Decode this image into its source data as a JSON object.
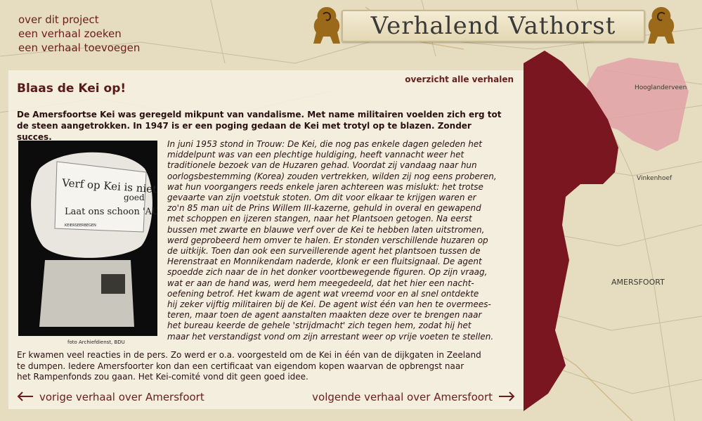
{
  "site": {
    "banner_title": "Verhalend Vathorst"
  },
  "nav": {
    "items": [
      "over dit project",
      "een verhaal zoeken",
      "een verhaal toevoegen"
    ]
  },
  "map_labels": {
    "label1": "Hooglanderveen",
    "label2": "Vinkenhoef",
    "label3": "AMERSFOORT"
  },
  "story": {
    "title": "Blaas de Kei op!",
    "overview_link": "overzicht alle verhalen",
    "lead": "De Amersfoortse Kei was geregeld mikpunt van vandalisme. Met name militairen voelden zich erg tot de steen aangetrokken. In 1947 is er een poging gedaan de Kei met trotyl op te blazen. Zonder succes.",
    "photo_text": [
      "Verf op Kei is niet",
      "goed",
      "Laat ons schoon 'AUB'",
      "KEIERSEERBEGEN"
    ],
    "photo_caption": "foto Archiefdienst, BDU",
    "body_lines": [
      "In juni 1953 stond in Trouw: De Kei, die nog pas enkele dagen geleden het",
      "middelpunt was van een plechtige huldiging, heeft vannacht weer het",
      "traditionele bezoek van de Huzaren gehad. Voordat zij vandaag naar hun",
      "oorlogsbestemming (Korea) zouden vertrekken, wilden zij nog eens proberen,",
      "wat hun voorgangers reeds enkele jaren achtereen was mislukt: het trotse",
      "gevaarte van zijn voetstuk stoten. Om dit voor elkaar te krijgen waren er",
      "zo'n 85 man uit de Prins Willem III-kazerne, gehuld in overal en gewapend",
      "met schoppen en ijzeren stangen, naar het Plantsoen getogen. Na eerst",
      "bussen met zwarte en blauwe verf over de Kei te hebben laten uitstromen,",
      "werd geprobeerd hem omver te halen. Er stonden verschillende huzaren op",
      "de uitkijk. Toen dan ook een surveillerende agent het plantsoen tussen de",
      "Herenstraat en Monnikendam naderde, klonk er een fluitsignaal. De agent",
      "spoedde zich naar de in het donker voortbewegende figuren. Op zijn vraag,",
      "wat er aan de hand was, werd hem meegedeeld, dat het hier een nacht-",
      "oefening betrof. Het kwam de agent wat vreemd voor en al snel ontdekte",
      "hij zeker vijftig militairen bij de Kei. De agent wist één van hen te overmees-",
      "teren, maar toen de agent aanstalten maakten deze over te brengen naar",
      "het bureau keerde de gehele 'strijdmacht' zich tegen hem, zodat hij het",
      "maar het verstandigst vond om zijn arrestant weer op vrije voeten te stellen."
    ],
    "after_lines": [
      "Er kwamen veel reacties in de pers. Zo werd er o.a. voorgesteld om de Kei in één van de dijkgaten in Zeeland",
      "te dumpen. Iedere Amersfoorter kon dan een certificaat van eigendom kopen waarvan de opbrengst naar",
      "het Rampenfonds zou gaan. Het Kei-comité vond dit geen goed idee."
    ],
    "prev_link": "vorige verhaal over Amersfoort",
    "next_link": "volgende verhaal over Amersfoort"
  },
  "colors": {
    "accent": "#6b1c1c",
    "map_region": "#7a1620",
    "map_region_light": "#e1a1a6",
    "map_bg": "#e6dcc0"
  }
}
